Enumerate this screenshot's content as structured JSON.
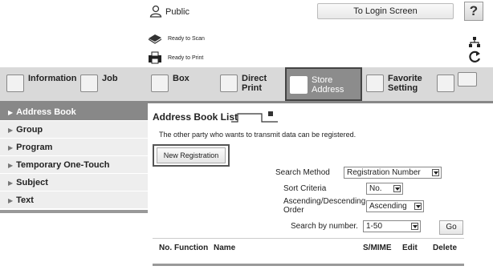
{
  "header": {
    "user_label": "Public",
    "login_button": "To Login Screen",
    "help_button": "?",
    "status": [
      {
        "icon": "scanner-icon",
        "text": "Ready to Scan"
      },
      {
        "icon": "printer-icon",
        "text": "Ready to Print"
      }
    ]
  },
  "tabs": [
    {
      "icon": "information-icon",
      "label": "Information"
    },
    {
      "icon": "job-icon",
      "label": "Job"
    },
    {
      "icon": "box-icon",
      "label": "Box"
    },
    {
      "icon": "direct-print-icon",
      "label": "Direct Print"
    },
    {
      "icon": "store-address-icon",
      "label": "Store Address",
      "active": true
    },
    {
      "icon": "favorite-setting-icon",
      "label": "Favorite Setting"
    }
  ],
  "sidebar": {
    "items": [
      {
        "label": "Address Book",
        "active": true
      },
      {
        "label": "Group"
      },
      {
        "label": "Program"
      },
      {
        "label": "Temporary One-Touch"
      },
      {
        "label": "Subject"
      },
      {
        "label": "Text"
      }
    ]
  },
  "main": {
    "title": "Address Book List",
    "description": "The other party who wants to transmit data can be registered.",
    "new_registration_button": "New Registration",
    "search_method": {
      "label": "Search Method",
      "value": "Registration Number"
    },
    "sort_criteria": {
      "label": "Sort Criteria",
      "value": "No."
    },
    "order": {
      "label_line1": "Ascending/Descending",
      "label_line2": "Order",
      "value": "Ascending"
    },
    "search_by_number": {
      "label": "Search by number.",
      "value": "1-50"
    },
    "go_button": "Go",
    "columns": [
      "No.",
      "Function",
      "Name",
      "S/MIME",
      "Edit",
      "Delete"
    ]
  },
  "colors": {
    "active_tab": "#8c8c8c",
    "tab_bar": "#d9d9d9",
    "sidebar_active": "#888888"
  }
}
